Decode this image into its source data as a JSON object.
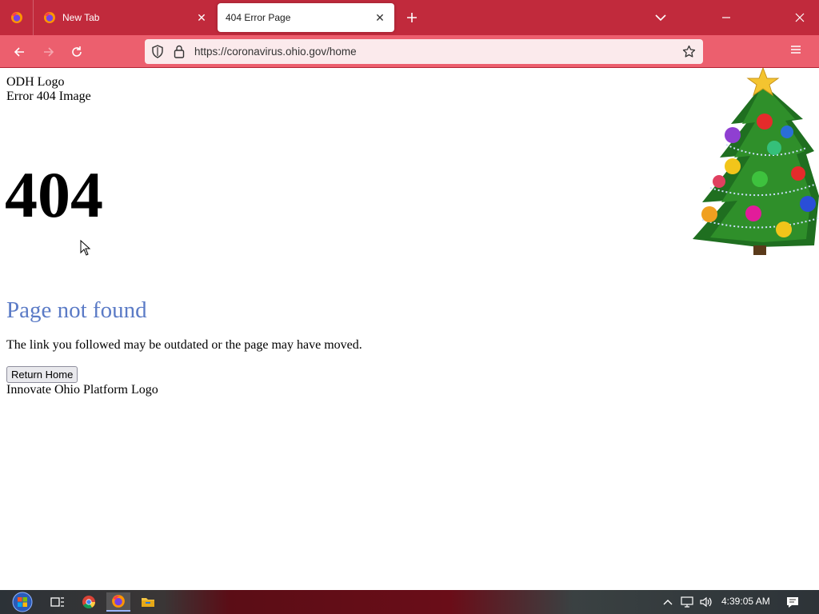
{
  "browser": {
    "tabs": [
      {
        "title": "New Tab",
        "active": false
      },
      {
        "title": "404 Error Page",
        "active": true
      }
    ],
    "url": "https://coronavirus.ohio.gov/home",
    "colors": {
      "tabstrip": "#c12a3c",
      "toolbar": "#ec5f6e",
      "urlbar": "#fbeaec"
    }
  },
  "page": {
    "odh_logo_alt": "ODH Logo",
    "error_image_alt": "Error 404 Image",
    "code": "404",
    "heading": "Page not found",
    "message": "The link you followed may be outdated or the page may have moved.",
    "return_button": "Return Home",
    "footer_logo_alt": "Innovate Ohio Platform Logo",
    "heading_color": "#5b7bc6"
  },
  "taskbar": {
    "pinned": [
      "start-button",
      "task-view",
      "chrome",
      "firefox",
      "file-explorer"
    ],
    "active": "firefox",
    "clock": "4:39:05 AM"
  }
}
